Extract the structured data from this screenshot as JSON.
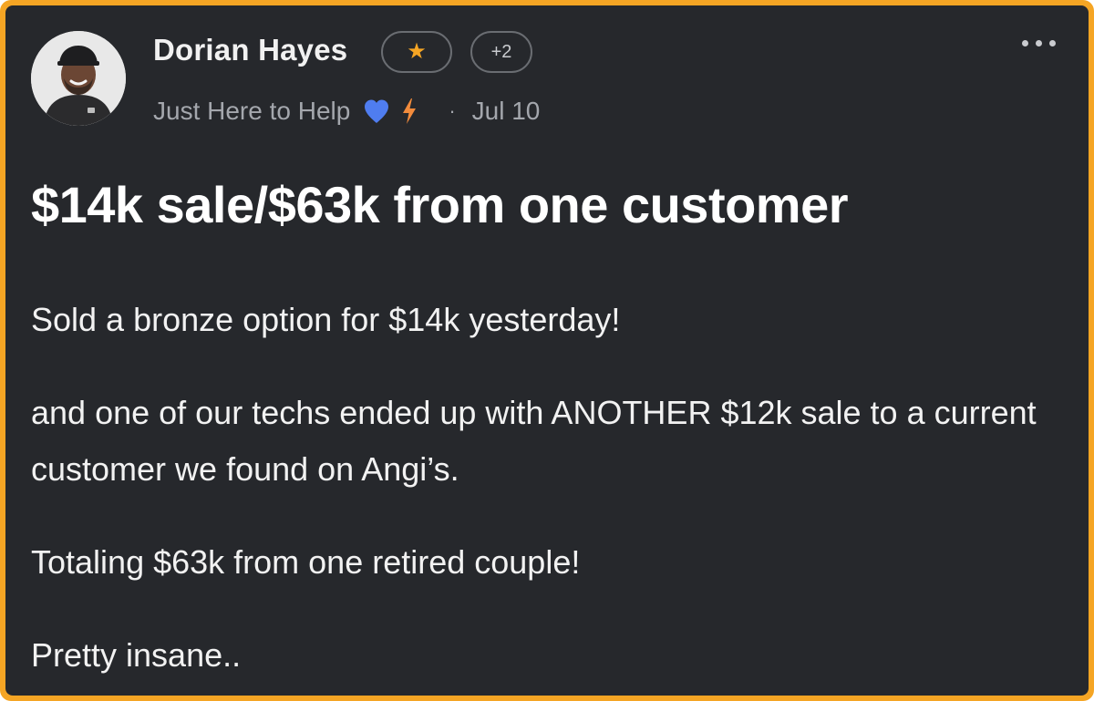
{
  "post": {
    "author": {
      "name": "Dorian Hayes",
      "avatar_icon": "person-avatar",
      "badge_icon": "star-icon",
      "badge_extra": "+2",
      "tagline": "Just Here to Help",
      "tagline_icons": [
        "blue-heart-icon",
        "lightning-bolt-icon"
      ],
      "date_separator": "·",
      "date": "Jul 10"
    },
    "menu_icon": "more-options-icon",
    "title": "$14k sale/$63k from one customer",
    "paragraphs": [
      "Sold a bronze option for $14k yesterday!",
      "and one of our techs ended up with ANOTHER $12k sale to a current customer we found on Angi’s.",
      "Totaling $63k from one retired couple!",
      "Pretty insane.."
    ]
  },
  "colors": {
    "frame": "#f5a524",
    "card_background": "#26282c",
    "star": "#f5a524",
    "heart": "#4f7df0",
    "bolt": "#f28b3c",
    "muted_text": "#a4a7ad"
  }
}
